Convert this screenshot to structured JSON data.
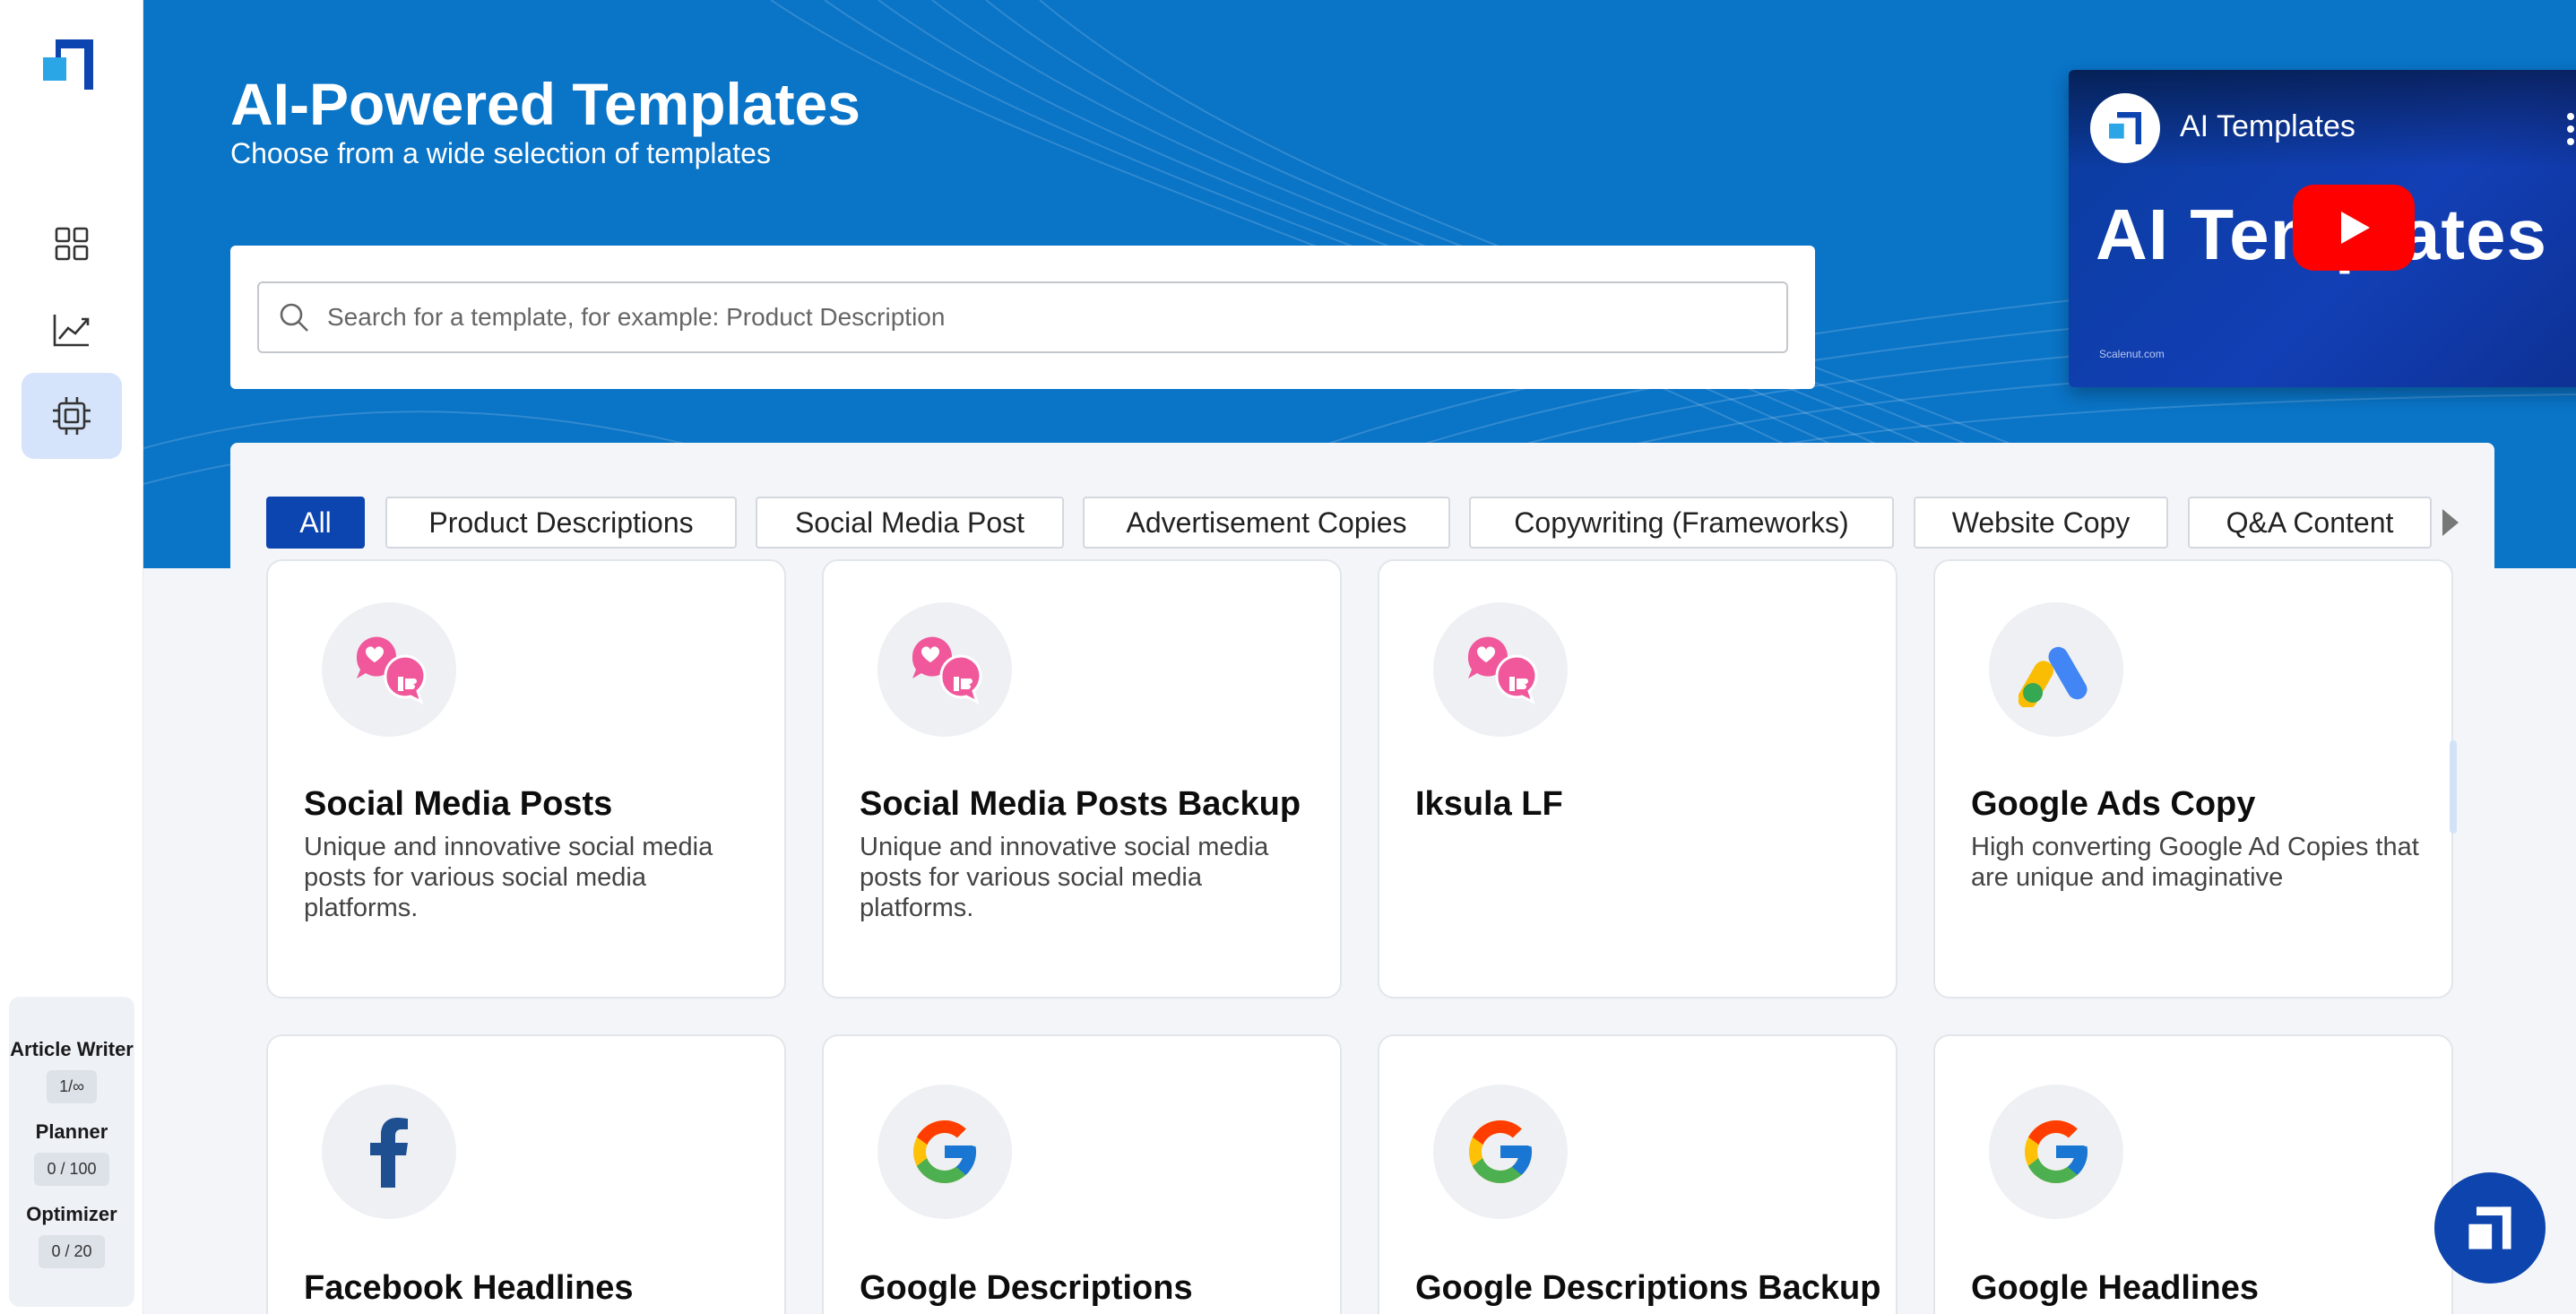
{
  "sidebar": {
    "nav": [
      {
        "icon": "grid-icon"
      },
      {
        "icon": "chart-line-icon"
      },
      {
        "icon": "chip-icon",
        "active": true
      }
    ],
    "usage": [
      {
        "label": "Article Writer",
        "count": "1/∞"
      },
      {
        "label": "Planner",
        "count": "0 / 100"
      },
      {
        "label": "Optimizer",
        "count": "0 / 20"
      }
    ]
  },
  "hero": {
    "title": "AI-Powered Templates",
    "subtitle": "Choose from a wide selection of templates"
  },
  "search": {
    "placeholder": "Search for a template, for example: Product Description"
  },
  "video": {
    "channel_title": "AI Templates",
    "big_text": "AI Templates",
    "footer": "Scalenut.com"
  },
  "filters": [
    "All",
    "Product Descriptions",
    "Social Media Post",
    "Advertisement Copies",
    "Copywriting (Frameworks)",
    "Website Copy",
    "Q&A Content"
  ],
  "filters_active": "All",
  "cards": [
    {
      "title": "Social Media Posts",
      "description": "Unique and innovative social media posts for various social media platforms.",
      "icon": "social-media-icon"
    },
    {
      "title": "Social Media Posts Backup",
      "description": "Unique and innovative social media posts for various social media platforms.",
      "icon": "social-media-icon"
    },
    {
      "title": "Iksula LF",
      "description": "",
      "icon": "social-media-icon"
    },
    {
      "title": "Google Ads Copy",
      "description": "High converting Google Ad Copies that are unique and imaginative",
      "icon": "google-ads-icon"
    },
    {
      "title": "Facebook Headlines",
      "description": "",
      "icon": "facebook-icon"
    },
    {
      "title": "Google Descriptions",
      "description": "",
      "icon": "google-icon"
    },
    {
      "title": "Google Descriptions Backup",
      "description": "",
      "icon": "google-icon"
    },
    {
      "title": "Google Headlines",
      "description": "",
      "icon": "google-icon"
    }
  ],
  "colors": {
    "brand_blue": "#0c44b0",
    "hero_blue": "#0a74c7",
    "youtube_red": "#ff0000",
    "social_pink": "#f0589b"
  }
}
